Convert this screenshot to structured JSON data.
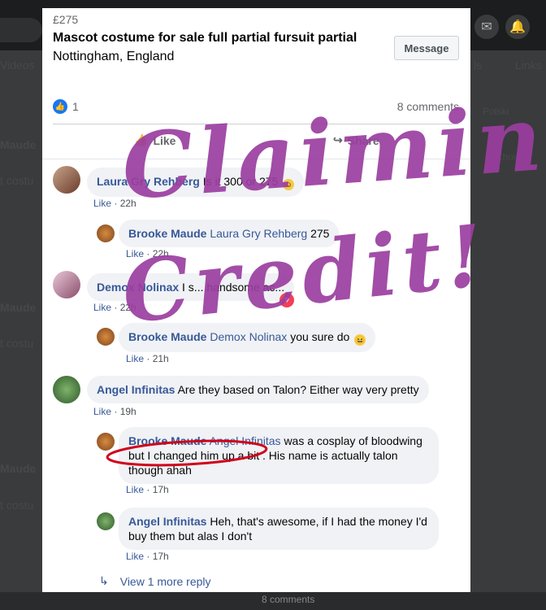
{
  "background": {
    "tabs": [
      "Videos",
      "ls",
      "Links"
    ],
    "side_texts": [
      "Polski",
      "Choices"
    ],
    "repeated_name": "Maude",
    "repeated_text": "t costu",
    "footer_text": "8 comments"
  },
  "listing": {
    "price": "£275",
    "title": "Mascot costume for sale full partial fursuit partial",
    "location": "Nottingham, England",
    "message_label": "Message",
    "like_count": "1",
    "comment_count": "8 comments",
    "like_label": "Like",
    "share_label": "Share"
  },
  "comments": [
    {
      "name": "Laura Gry Rehberg",
      "text": "Is it 300 or 275",
      "like": "Like",
      "time": "22h"
    },
    {
      "name": "Brooke Maude",
      "mention": "Laura Gry Rehberg",
      "text": "275",
      "like": "Like",
      "time": "22h"
    },
    {
      "name": "Demox Nolinax",
      "text": "I s... handsome ac...",
      "like": "Like",
      "time": "22h"
    },
    {
      "name": "Brooke Maude",
      "mention": "Demox Nolinax",
      "text": "you sure do",
      "like": "Like",
      "time": "21h"
    },
    {
      "name": "Angel Infinitas",
      "text": "Are they based on Talon? Either way very pretty",
      "like": "Like",
      "time": "19h"
    },
    {
      "name": "Brooke Maude",
      "mention": "Angel Infinitas",
      "text": "was a cosplay of bloodwing but I changed him up a bit . His name is actually talon though ahah",
      "like": "Like",
      "time": "17h"
    },
    {
      "name": "Angel Infinitas",
      "text": "Heh, that's awesome, if I had the money I'd buy them but alas I don't",
      "like": "Like",
      "time": "17h"
    }
  ],
  "more_replies": "View 1 more reply",
  "annotation": {
    "line1": "Claiming",
    "line2": "Credit!",
    "color": "#9b3ea0",
    "circle_color": "#d0021b"
  }
}
